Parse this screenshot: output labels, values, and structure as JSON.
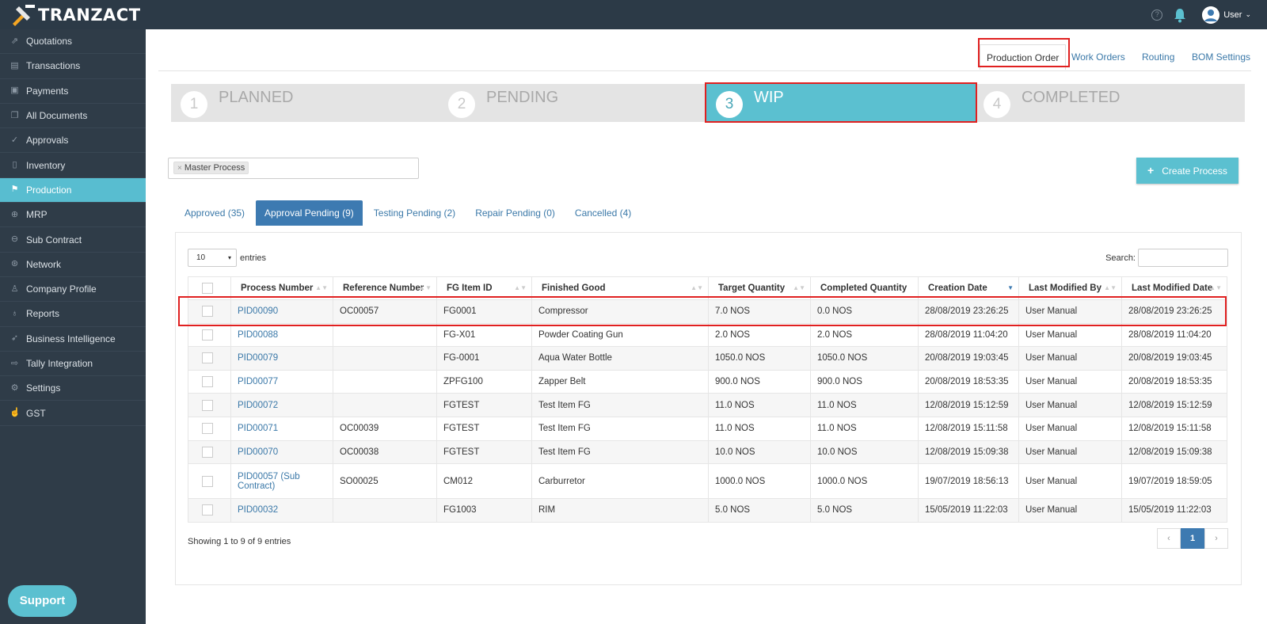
{
  "app": {
    "brand": "TRANZACT",
    "user_label": "User"
  },
  "sidebar": {
    "items": [
      {
        "label": "Quotations",
        "icon": "share-arrow-icon",
        "glyph": "⇗"
      },
      {
        "label": "Transactions",
        "icon": "ledger-icon",
        "glyph": "▤"
      },
      {
        "label": "Payments",
        "icon": "cash-icon",
        "glyph": "▣"
      },
      {
        "label": "All Documents",
        "icon": "documents-icon",
        "glyph": "❐"
      },
      {
        "label": "Approvals",
        "icon": "check-circle-icon",
        "glyph": "✓"
      },
      {
        "label": "Inventory",
        "icon": "clipboard-icon",
        "glyph": "▯"
      },
      {
        "label": "Production",
        "icon": "tag-icon",
        "glyph": "⚑"
      },
      {
        "label": "MRP",
        "icon": "crosshair-icon",
        "glyph": "⊕"
      },
      {
        "label": "Sub Contract",
        "icon": "arrow-circle-icon",
        "glyph": "⊖"
      },
      {
        "label": "Network",
        "icon": "globe-icon",
        "glyph": "⊛"
      },
      {
        "label": "Company Profile",
        "icon": "person-icon",
        "glyph": "♙"
      },
      {
        "label": "Reports",
        "icon": "bulb-icon",
        "glyph": "♁"
      },
      {
        "label": "Business Intelligence",
        "icon": "rocket-icon",
        "glyph": "➶"
      },
      {
        "label": "Tally Integration",
        "icon": "export-icon",
        "glyph": "⇨"
      },
      {
        "label": "Settings",
        "icon": "gear-icon",
        "glyph": "⚙"
      },
      {
        "label": "GST",
        "icon": "hand-icon",
        "glyph": "☝"
      }
    ],
    "active_index": 6,
    "support_label": "Support"
  },
  "header_tabs": [
    "Production Order",
    "Work Orders",
    "Routing",
    "BOM Settings"
  ],
  "steps": [
    {
      "num": "1",
      "label": "PLANNED"
    },
    {
      "num": "2",
      "label": "PENDING"
    },
    {
      "num": "3",
      "label": "WIP"
    },
    {
      "num": "4",
      "label": "COMPLETED"
    }
  ],
  "filter": {
    "chip_x": "×",
    "chip_label": "Master Process"
  },
  "create_button": {
    "plus": "+",
    "label": "Create Process"
  },
  "sub_tabs": [
    "Approved (35)",
    "Approval Pending (9)",
    "Testing Pending (2)",
    "Repair Pending (0)",
    "Cancelled (4)"
  ],
  "entries": {
    "value": "10",
    "arrow": "▾",
    "label": "entries"
  },
  "search_label": "Search:",
  "table": {
    "columns": [
      "Process Number",
      "Reference Number",
      "FG Item ID",
      "Finished Good",
      "Target Quantity",
      "Completed Quantity",
      "Creation Date",
      "Last Modified By",
      "Last Modified Date"
    ],
    "rows": [
      [
        "PID00090",
        "OC00057",
        "FG0001",
        "Compressor",
        "7.0 NOS",
        "0.0 NOS",
        "28/08/2019 23:26:25",
        "User Manual",
        "28/08/2019 23:26:25"
      ],
      [
        "PID00088",
        "",
        "FG-X01",
        "Powder Coating Gun",
        "2.0 NOS",
        "2.0 NOS",
        "28/08/2019 11:04:20",
        "User Manual",
        "28/08/2019 11:04:20"
      ],
      [
        "PID00079",
        "",
        "FG-0001",
        "Aqua Water Bottle",
        "1050.0 NOS",
        "1050.0 NOS",
        "20/08/2019 19:03:45",
        "User Manual",
        "20/08/2019 19:03:45"
      ],
      [
        "PID00077",
        "",
        "ZPFG100",
        "Zapper Belt",
        "900.0 NOS",
        "900.0 NOS",
        "20/08/2019 18:53:35",
        "User Manual",
        "20/08/2019 18:53:35"
      ],
      [
        "PID00072",
        "",
        "FGTEST",
        "Test Item FG",
        "11.0 NOS",
        "11.0 NOS",
        "12/08/2019 15:12:59",
        "User Manual",
        "12/08/2019 15:12:59"
      ],
      [
        "PID00071",
        "OC00039",
        "FGTEST",
        "Test Item FG",
        "11.0 NOS",
        "11.0 NOS",
        "12/08/2019 15:11:58",
        "User Manual",
        "12/08/2019 15:11:58"
      ],
      [
        "PID00070",
        "OC00038",
        "FGTEST",
        "Test Item FG",
        "10.0 NOS",
        "10.0 NOS",
        "12/08/2019 15:09:38",
        "User Manual",
        "12/08/2019 15:09:38"
      ],
      [
        "PID00057 (Sub Contract)",
        "SO00025",
        "CM012",
        "Carburretor",
        "1000.0 NOS",
        "1000.0 NOS",
        "19/07/2019 18:56:13",
        "User Manual",
        "19/07/2019 18:59:05"
      ],
      [
        "PID00032",
        "",
        "FG1003",
        "RIM",
        "5.0 NOS",
        "5.0 NOS",
        "15/05/2019 11:22:03",
        "User Manual",
        "15/05/2019 11:22:03"
      ]
    ]
  },
  "showing_text": "Showing 1 to 9 of 9 entries",
  "pager": {
    "prev": "‹",
    "page": "1",
    "next": "›"
  },
  "colors": {
    "accent": "#5bc0d0",
    "primary": "#3d7ab1",
    "sidebar": "#2f3c48",
    "highlight": "#e02020"
  }
}
